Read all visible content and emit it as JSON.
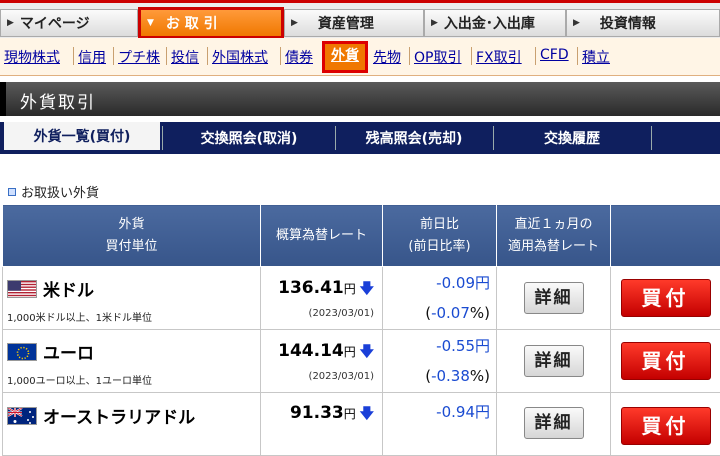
{
  "top_nav": {
    "tabs": [
      {
        "label": "マイページ",
        "active": false
      },
      {
        "label": "お 取 引",
        "active": true
      },
      {
        "label": "資産管理",
        "active": false
      },
      {
        "label": "入出金･入出庫",
        "active": false
      },
      {
        "label": "投資情報",
        "active": false
      }
    ]
  },
  "sub_nav": {
    "items": [
      "現物株式",
      "信用",
      "プチ株",
      "投信",
      "外国株式",
      "債券",
      "外貨",
      "先物",
      "OP取引",
      "FX取引",
      "CFD",
      "積立"
    ],
    "selected": "外貨"
  },
  "page_title": "外貨取引",
  "sub_tabs": [
    "外貨一覧(買付)",
    "交換照会(取消)",
    "残高照会(売却)",
    "交換履歴"
  ],
  "section_label": "お取扱い外貨",
  "table": {
    "headers": {
      "currency_line1": "外貨",
      "currency_line2": "買付単位",
      "rate": "概算為替レート",
      "change_line1": "前日比",
      "change_line2": "(前日比率)",
      "recent_line1": "直近１ヵ月の",
      "recent_line2": "適用為替レート"
    },
    "rows": [
      {
        "flag": "us-flag",
        "name": "米ドル",
        "unit": "1,000米ドル以上、1米ドル単位",
        "rate": "136.41",
        "rate_unit": "円",
        "trend_icon": "down-arrow-icon",
        "date": "(2023/03/01)",
        "change": "-0.09",
        "change_unit": "円",
        "change_pct": "-0.07",
        "pct_unit": "%",
        "detail_label": "詳細",
        "buy_label": "買付"
      },
      {
        "flag": "eu-flag",
        "name": "ユーロ",
        "unit": "1,000ユーロ以上、1ユーロ単位",
        "rate": "144.14",
        "rate_unit": "円",
        "trend_icon": "down-arrow-icon",
        "date": "(2023/03/01)",
        "change": "-0.55",
        "change_unit": "円",
        "change_pct": "-0.38",
        "pct_unit": "%",
        "detail_label": "詳細",
        "buy_label": "買付"
      },
      {
        "flag": "au-flag",
        "name": "オーストラリアドル",
        "unit": "",
        "rate": "91.33",
        "rate_unit": "円",
        "trend_icon": "down-arrow-icon",
        "date": "",
        "change": "-0.94",
        "change_unit": "円",
        "change_pct": "",
        "pct_unit": "",
        "detail_label": "詳細",
        "buy_label": "買付"
      }
    ]
  },
  "colors": {
    "accent": "#f07800",
    "nav_dark": "#0f1f5e",
    "header_blue": "#37558a",
    "buy_red": "#c40000",
    "down_blue": "#1a4bd1"
  }
}
